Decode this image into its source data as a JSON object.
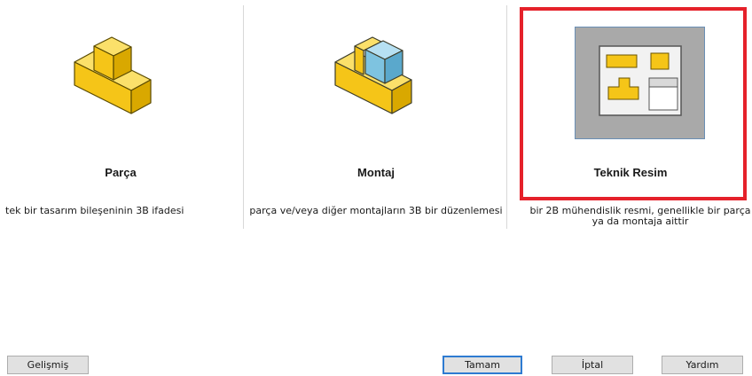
{
  "options": [
    {
      "title": "Parça",
      "description": "tek bir tasarım bileşeninin 3B ifadesi",
      "icon": "part-icon"
    },
    {
      "title": "Montaj",
      "description": "parça ve/veya diğer montajların 3B bir düzenlemesi",
      "icon": "assembly-icon"
    },
    {
      "title": "Teknik Resim",
      "description": "bir 2B mühendislik resmi, genellikle bir parça ya da montaja aittir",
      "icon": "drawing-icon",
      "selected": true
    }
  ],
  "buttons": {
    "advanced": "Gelişmiş",
    "ok": "Tamam",
    "cancel": "İptal",
    "help": "Yardım"
  },
  "colors": {
    "selection_border": "#e5212a",
    "part_yellow": "#f5c518",
    "assembly_blue": "#7ec3e0",
    "drawing_bg": "#a9a9a9"
  }
}
